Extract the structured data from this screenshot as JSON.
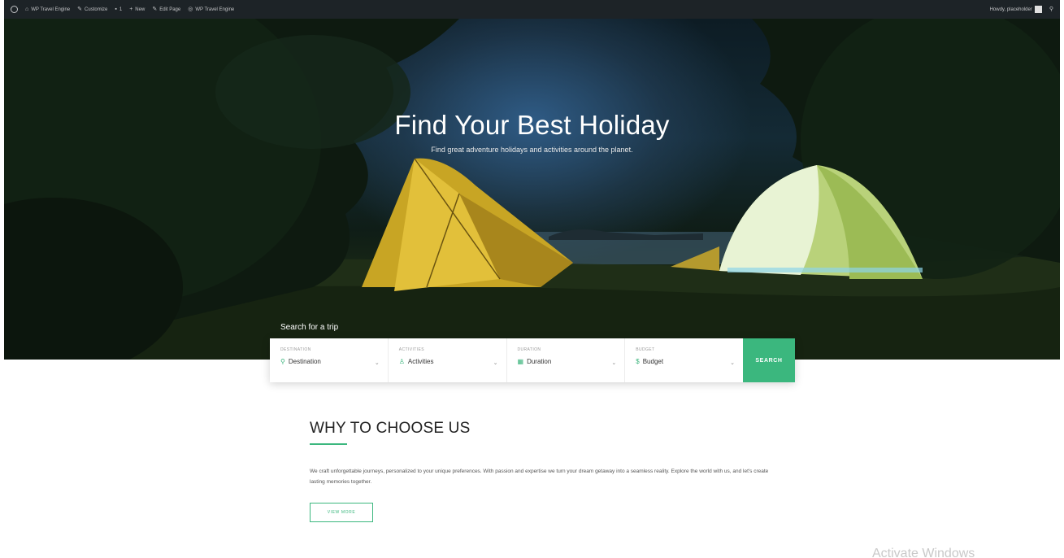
{
  "adminbar": {
    "items": [
      "WP Travel Engine",
      "Customize",
      "1",
      "New",
      "Edit Page",
      "WP Travel Engine"
    ],
    "user": "Howdy, placeholder"
  },
  "hero": {
    "title": "Find Your Best Holiday",
    "subtitle": "Find great adventure holidays and activities around the planet."
  },
  "search": {
    "label": "Search for a trip",
    "fields": [
      {
        "label": "Destination",
        "value": "Destination",
        "icon": "map-pin-icon"
      },
      {
        "label": "Activities",
        "value": "Activities",
        "icon": "person-icon"
      },
      {
        "label": "Duration",
        "value": "Duration",
        "icon": "calendar-icon"
      },
      {
        "label": "Budget",
        "value": "Budget",
        "icon": "dollar-icon"
      }
    ],
    "button": "SEARCH"
  },
  "why": {
    "title": "WHY TO CHOOSE US",
    "text": "We craft unforgettable journeys, personalized to your unique preferences. With passion and expertise we turn your dream getaway into a seamless reality. Explore the world with us, and let's create lasting memories together.",
    "button": "VIEW MORE"
  },
  "watermark": "Activate Windows",
  "colors": {
    "accent": "#3bb77e",
    "adminbar": "#1d2327"
  }
}
